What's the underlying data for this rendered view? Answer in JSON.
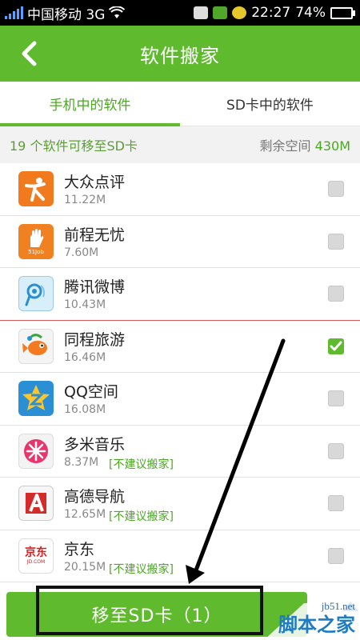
{
  "status_bar": {
    "carrier": "中国移动 3G",
    "time": "22:27",
    "battery": "74%",
    "battery_level": 0.74
  },
  "header": {
    "title": "软件搬家",
    "back_icon": "chevron-left-icon"
  },
  "tabs": [
    {
      "label": "手机中的软件",
      "active": true
    },
    {
      "label": "SD卡中的软件",
      "active": false
    }
  ],
  "info": {
    "left": "19 个软件可移至SD卡",
    "right_label": "剩余空间",
    "right_value": "430M"
  },
  "apps": [
    {
      "name": "大众点评",
      "size": "11.22M",
      "warn": "",
      "checked": false,
      "icon": "dianping-icon"
    },
    {
      "name": "前程无忧",
      "size": "7.60M",
      "warn": "",
      "checked": false,
      "icon": "51job-icon"
    },
    {
      "name": "腾讯微博",
      "size": "10.43M",
      "warn": "",
      "checked": false,
      "icon": "tencent-weibo-icon"
    },
    {
      "name": "同程旅游",
      "size": "16.46M",
      "warn": "",
      "checked": true,
      "icon": "tongcheng-icon"
    },
    {
      "name": "QQ空间",
      "size": "16.08M",
      "warn": "",
      "checked": false,
      "icon": "qzone-icon"
    },
    {
      "name": "多米音乐",
      "size": "8.37M",
      "warn": "[不建议搬家]",
      "checked": false,
      "icon": "duomi-icon"
    },
    {
      "name": "高德导航",
      "size": "12.65M",
      "warn": "[不建议搬家]",
      "checked": false,
      "icon": "amap-icon"
    },
    {
      "name": "京东",
      "size": "20.15M",
      "warn": "[不建议搬家]",
      "checked": false,
      "icon": "jd-icon"
    }
  ],
  "icon_text": {
    "job": "51Job",
    "jd_main": "京东",
    "jd_sub": "JD.COM"
  },
  "bottom": {
    "button_label": "移至SD卡（1）"
  },
  "watermark": {
    "site": "jb51.net",
    "name": "脚本之家"
  },
  "colors": {
    "brand_green": "#5fba2e",
    "tab_active": "#4aa822"
  }
}
